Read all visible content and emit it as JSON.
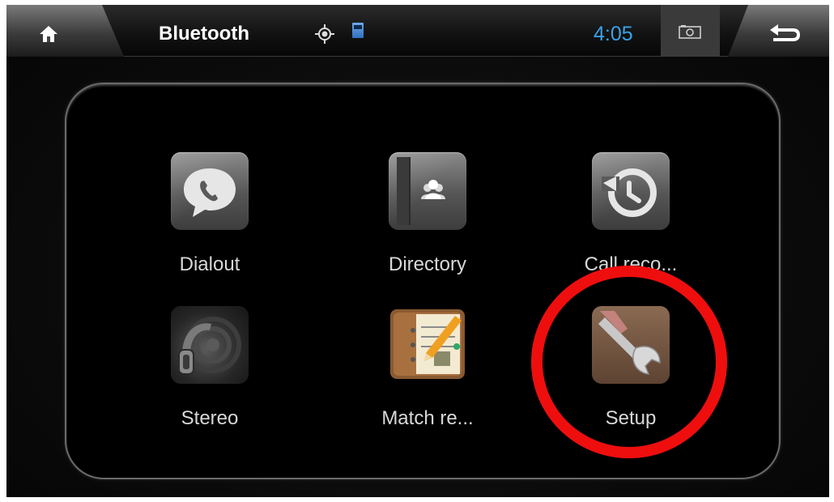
{
  "statusbar": {
    "title": "Bluetooth",
    "time": "4:05"
  },
  "apps": [
    {
      "label": "Dialout",
      "icon": "phone-bubble-icon"
    },
    {
      "label": "Directory",
      "icon": "contacts-book-icon"
    },
    {
      "label": "Call reco...",
      "icon": "history-icon"
    },
    {
      "label": "Stereo",
      "icon": "stereo-headphone-icon"
    },
    {
      "label": "Match re...",
      "icon": "notebook-pencil-icon"
    },
    {
      "label": "Setup",
      "icon": "wrench-icon"
    }
  ],
  "colors": {
    "clock": "#3aa2e8",
    "highlight": "#ef0e0e"
  }
}
